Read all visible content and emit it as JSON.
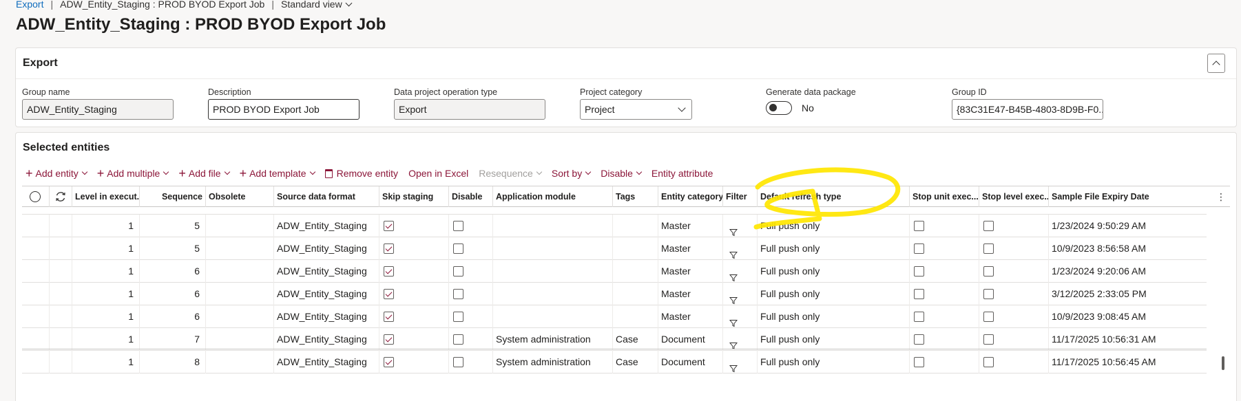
{
  "breadcrumb": {
    "root": "Export",
    "job": "ADW_Entity_Staging : PROD BYOD Export Job",
    "view": "Standard view"
  },
  "page_title": "ADW_Entity_Staging : PROD BYOD Export Job",
  "export_section": {
    "title": "Export",
    "group_name_label": "Group name",
    "group_name_value": "ADW_Entity_Staging",
    "description_label": "Description",
    "description_value": "PROD BYOD Export Job",
    "operation_type_label": "Data project operation type",
    "operation_type_value": "Export",
    "project_category_label": "Project category",
    "project_category_value": "Project",
    "generate_package_label": "Generate data package",
    "generate_package_value": "No",
    "group_id_label": "Group ID",
    "group_id_value": "{83C31E47-B45B-4803-8D9B-F0..."
  },
  "entities_section": {
    "title": "Selected entities",
    "toolbar": {
      "add_entity": "Add entity",
      "add_multiple": "Add multiple",
      "add_file": "Add file",
      "add_template": "Add template",
      "remove_entity": "Remove entity",
      "open_in_excel": "Open in Excel",
      "resequence": "Resequence",
      "sort_by": "Sort by",
      "disable": "Disable",
      "entity_attribute": "Entity attribute"
    },
    "columns": {
      "level": "Level in execut...",
      "sequence": "Sequence",
      "obsolete": "Obsolete",
      "source_format": "Source data format",
      "skip_staging": "Skip staging",
      "disable": "Disable",
      "app_module": "Application module",
      "tags": "Tags",
      "entity_category": "Entity category",
      "filter": "Filter",
      "refresh_type": "Default refresh type",
      "stop_unit": "Stop unit exec...",
      "stop_level": "Stop level exec...",
      "expiry": "Sample File Expiry Date"
    },
    "rows": [
      {
        "level": "1",
        "sequence": "5",
        "source": "ADW_Entity_Staging",
        "skip": true,
        "disable": false,
        "module": "",
        "tags": "",
        "category": "Master",
        "refresh": "Full push only",
        "stop_unit": false,
        "stop_level": false,
        "expiry": "1/23/2024 9:50:29 AM"
      },
      {
        "level": "1",
        "sequence": "5",
        "source": "ADW_Entity_Staging",
        "skip": true,
        "disable": false,
        "module": "",
        "tags": "",
        "category": "Master",
        "refresh": "Full push only",
        "stop_unit": false,
        "stop_level": false,
        "expiry": "10/9/2023 8:56:58 AM"
      },
      {
        "level": "1",
        "sequence": "6",
        "source": "ADW_Entity_Staging",
        "skip": true,
        "disable": false,
        "module": "",
        "tags": "",
        "category": "Master",
        "refresh": "Full push only",
        "stop_unit": false,
        "stop_level": false,
        "expiry": "1/23/2024 9:20:06 AM"
      },
      {
        "level": "1",
        "sequence": "6",
        "source": "ADW_Entity_Staging",
        "skip": true,
        "disable": false,
        "module": "",
        "tags": "",
        "category": "Master",
        "refresh": "Full push only",
        "stop_unit": false,
        "stop_level": false,
        "expiry": "3/12/2025 2:33:05 PM"
      },
      {
        "level": "1",
        "sequence": "6",
        "source": "ADW_Entity_Staging",
        "skip": true,
        "disable": false,
        "module": "",
        "tags": "",
        "category": "Master",
        "refresh": "Full push only",
        "stop_unit": false,
        "stop_level": false,
        "expiry": "10/9/2023 9:08:45 AM"
      },
      {
        "level": "1",
        "sequence": "7",
        "source": "ADW_Entity_Staging",
        "skip": true,
        "disable": false,
        "module": "System administration",
        "tags": "Case",
        "category": "Document",
        "refresh": "Full push only",
        "stop_unit": false,
        "stop_level": false,
        "expiry": "11/17/2025 10:56:31 AM"
      },
      {
        "level": "1",
        "sequence": "8",
        "source": "ADW_Entity_Staging",
        "skip": true,
        "disable": false,
        "module": "System administration",
        "tags": "Case",
        "category": "Document",
        "refresh": "Full push only",
        "stop_unit": false,
        "stop_level": false,
        "expiry": "11/17/2025 10:56:45 AM"
      }
    ]
  },
  "colors": {
    "accent": "#8b1538",
    "link": "#0f6cbd",
    "highlight": "#ffe600"
  }
}
